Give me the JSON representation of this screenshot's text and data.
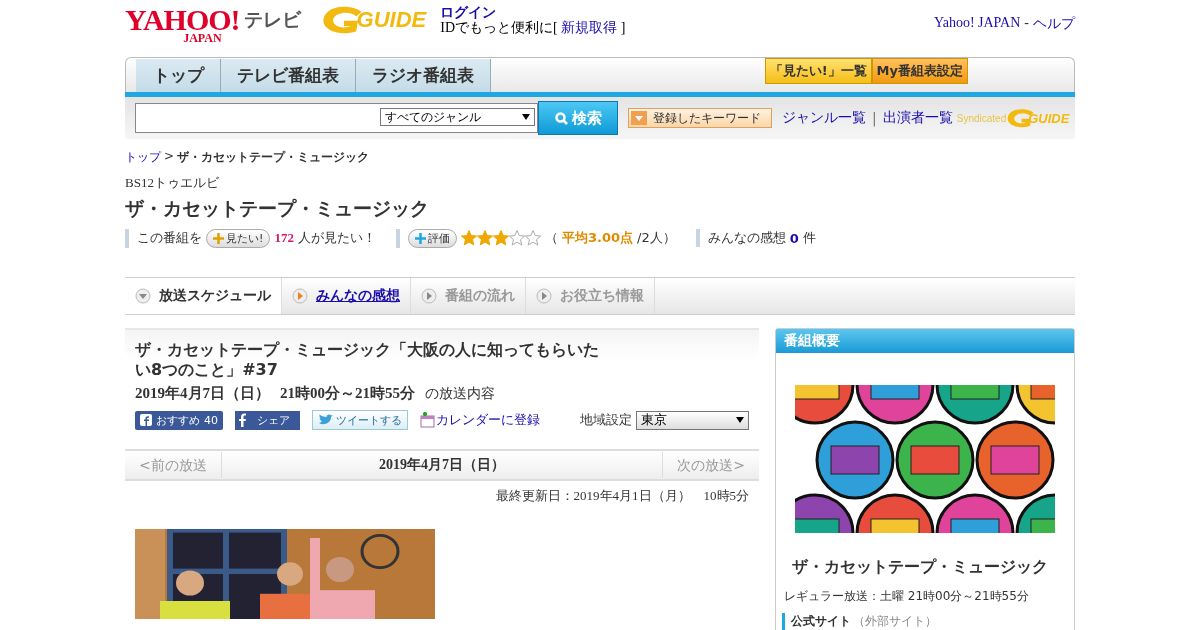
{
  "header": {
    "logo": "YAHOO!",
    "logo_sub": "JAPAN",
    "site": "テレビ",
    "guide_logo": "GUIDE",
    "login": "ログイン",
    "id_prompt": "IDでもっと便利に[",
    "signup": "新規取得",
    "bracket": "]",
    "links": [
      "Yahoo! JAPAN",
      "ヘルプ"
    ],
    "separator": "-"
  },
  "nav": {
    "tabs": [
      {
        "label": "トップ",
        "selected": false
      },
      {
        "label": "テレビ番組表",
        "selected": false
      },
      {
        "label": "ラジオ番組表",
        "selected": false
      }
    ],
    "buttons": [
      "「見たい!」一覧",
      "My番組表設定"
    ]
  },
  "search": {
    "genre": "すべてのジャンル",
    "button": "検索",
    "keyword_button": "登録したキーワード",
    "links": [
      "ジャンル一覧",
      "出演者一覧"
    ],
    "link_separator": "|",
    "syndicated": "Syndicated",
    "guide_logo": "GUIDE"
  },
  "breadcrumb": {
    "link": "トップ",
    "separator": ">",
    "current": "ザ・カセットテープ・ミュージック"
  },
  "channel": "BS12トゥエルビ",
  "title": "ザ・カセットテープ・ミュージック",
  "stats": {
    "want_prefix": "この番組を",
    "want_button": "見たい!",
    "want_count": "172",
    "want_suffix": "人が見たい！",
    "rate_button": "評価",
    "stars": 3,
    "rating_open": "（",
    "rating_avg": "平均3.00点",
    "rating_count": "/2人）",
    "impressions_label": "みんなの感想",
    "impressions_count": "0",
    "impressions_unit": "件"
  },
  "subtabs": [
    {
      "label": "放送スケジュール",
      "selected": true,
      "disabled": false
    },
    {
      "label": "みんなの感想",
      "selected": false,
      "disabled": false
    },
    {
      "label": "番組の流れ",
      "selected": false,
      "disabled": true
    },
    {
      "label": "お役立ち情報",
      "selected": false,
      "disabled": true
    }
  ],
  "episode": {
    "title": "ザ・カセットテープ・ミュージック「大阪の人に知ってもらいたい8つのこと」#37",
    "date": "2019年4月7日（日）",
    "time": "21時00分～21時55分",
    "suffix": "の放送内容",
    "like": "おすすめ",
    "like_count": "40",
    "share": "シェア",
    "tweet": "ツイートする",
    "calendar": "カレンダーに登録",
    "region_label": "地域設定",
    "region": "東京"
  },
  "pager": {
    "prev": "<前の放送",
    "current": "2019年4月7日（日）",
    "next": "次の放送>"
  },
  "updated": "最終更新日：2019年4月1日（月）　10時5分",
  "sidebar": {
    "heading": "番組概要",
    "title": "ザ・カセットテープ・ミュージック",
    "regular": "レギュラー放送：土曜 21時00分～21時55分",
    "official": "公式サイト",
    "official_note": "（外部サイト）"
  }
}
